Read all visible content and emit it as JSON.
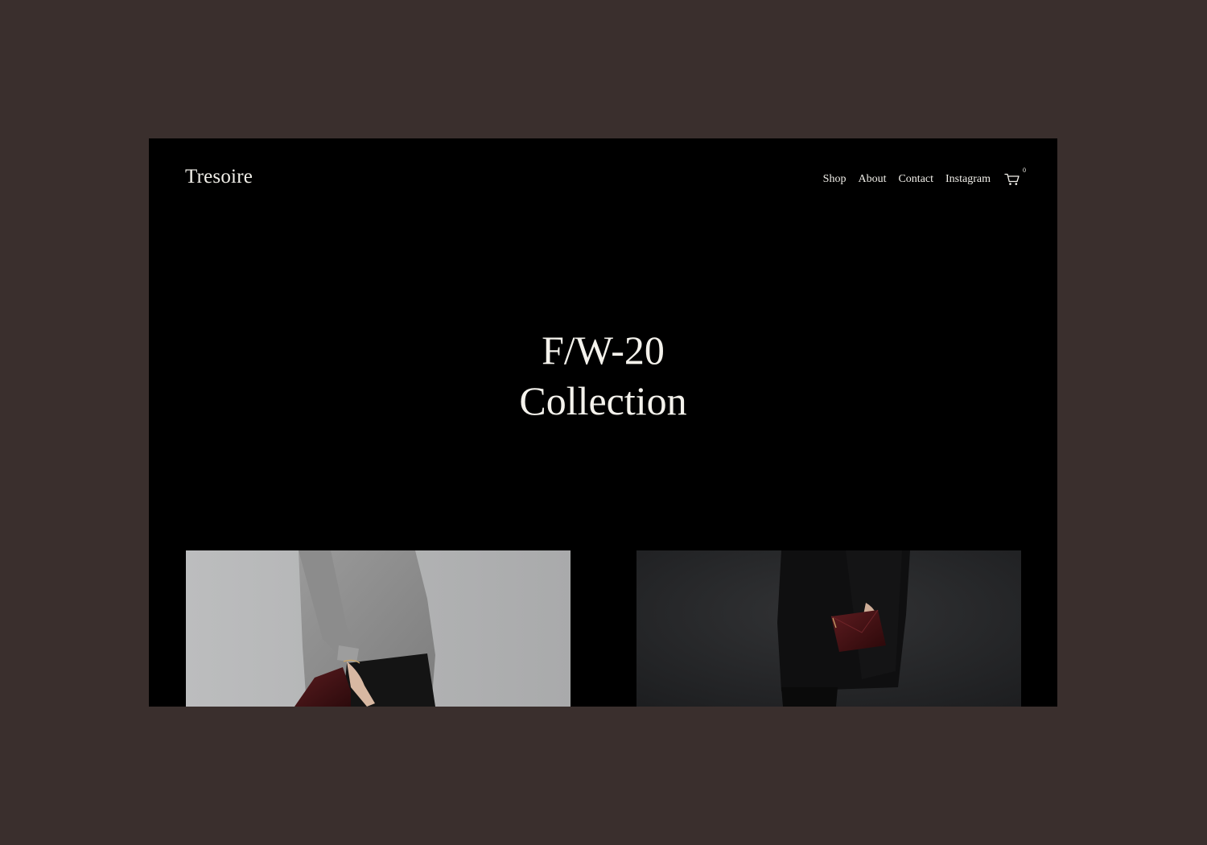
{
  "brand": {
    "name": "Tresoire"
  },
  "nav": {
    "items": [
      {
        "label": "Shop"
      },
      {
        "label": "About"
      },
      {
        "label": "Contact"
      },
      {
        "label": "Instagram"
      }
    ],
    "cart": {
      "icon": "cart-icon",
      "count": "0"
    }
  },
  "hero": {
    "line1": "F/W-20",
    "line2": "Collection"
  },
  "products": [
    {
      "image": "model-grey-sweater-burgundy-clutch-photo"
    },
    {
      "image": "model-black-coat-burgundy-clutch-photo"
    }
  ],
  "colors": {
    "backdrop": "#3a2f2d",
    "page": "#000000",
    "text": "#f2f0ea",
    "accent_leather": "#4a1418"
  }
}
